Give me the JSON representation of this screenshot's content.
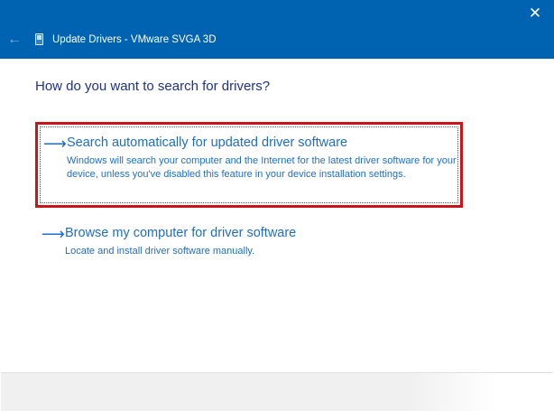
{
  "window": {
    "title": "Update Drivers - VMware SVGA 3D",
    "close_glyph": "✕",
    "back_glyph": "←"
  },
  "main": {
    "question": "How do you want to search for drivers?",
    "options": [
      {
        "title": "Search automatically for updated driver software",
        "description": "Windows will search your computer and the Internet for the latest driver software for your device, unless you've disabled this feature in your device installation settings.",
        "icon": "arrow-right-icon"
      },
      {
        "title": "Browse my computer for driver software",
        "description": "Locate and install driver software manually.",
        "icon": "arrow-right-icon"
      }
    ]
  },
  "colors": {
    "titlebar": "#0063b1",
    "link": "#1e6ec8",
    "heading": "#1e3287",
    "highlight_border": "#c8141a"
  }
}
